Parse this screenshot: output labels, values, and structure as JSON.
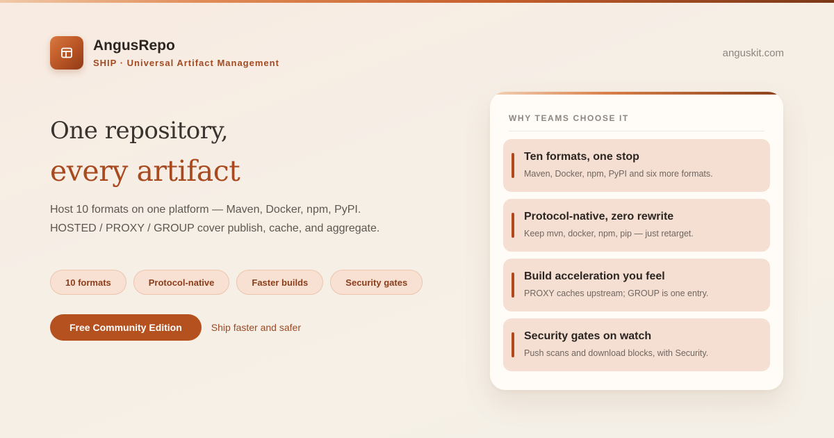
{
  "brand": {
    "name": "AngusRepo",
    "tagline": "SHIP · Universal Artifact Management",
    "logo_icon": "box-window-icon",
    "site": "anguskit.com"
  },
  "hero": {
    "line1": "One repository,",
    "line2": "every artifact",
    "desc1": "Host 10 formats on one platform — Maven, Docker, npm, PyPI.",
    "desc2": "HOSTED / PROXY / GROUP cover publish, cache, and aggregate."
  },
  "pills": [
    "10 formats",
    "Protocol-native",
    "Faster builds",
    "Security gates"
  ],
  "cta": {
    "button": "Free Community Edition",
    "note": "Ship faster and safer"
  },
  "card": {
    "title": "WHY TEAMS CHOOSE IT",
    "items": [
      {
        "title": "Ten formats, one stop",
        "desc": "Maven, Docker, npm, PyPI and six more formats."
      },
      {
        "title": "Protocol-native, zero rewrite",
        "desc": "Keep mvn, docker, npm, pip — just retarget."
      },
      {
        "title": "Build acceleration you feel",
        "desc": "PROXY caches upstream; GROUP is one entry."
      },
      {
        "title": "Security gates on watch",
        "desc": "Push scans and download blocks, with Security."
      }
    ]
  },
  "colors": {
    "accent": "#b5501f",
    "accent_text": "#a8491f",
    "pill_bg": "#f8e1d3",
    "card_item_bg": "#f5dfd2",
    "background": "#f6efe6"
  }
}
